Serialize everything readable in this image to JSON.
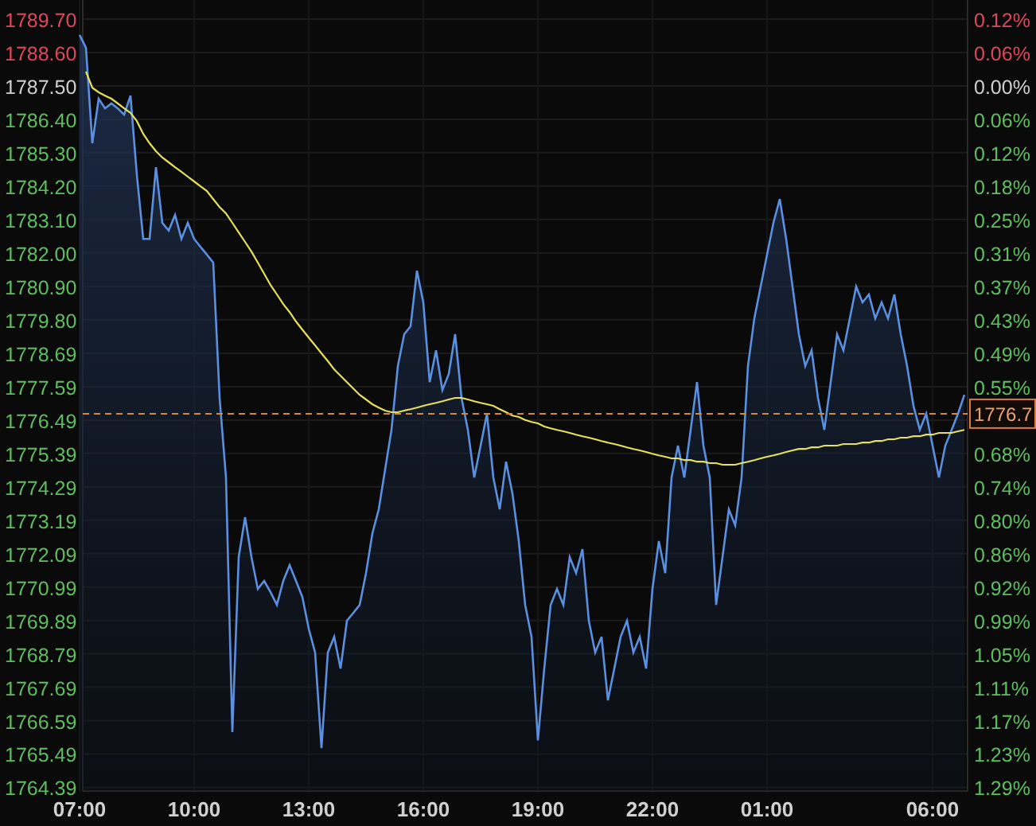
{
  "chart_data": {
    "type": "area",
    "grid": true,
    "ylim": [
      1764.27,
      1790.33
    ],
    "ref_lines": [
      {
        "axis": "y",
        "value": 1776.7,
        "label": "1776.7",
        "color": "#d08a3a"
      }
    ],
    "categories": [
      "07:00",
      null,
      null,
      null,
      null,
      null,
      null,
      null,
      null,
      null,
      null,
      null,
      null,
      null,
      null,
      null,
      null,
      null,
      "10:00",
      null,
      null,
      null,
      null,
      null,
      null,
      null,
      null,
      null,
      null,
      null,
      null,
      null,
      null,
      null,
      null,
      null,
      "13:00",
      null,
      null,
      null,
      null,
      null,
      null,
      null,
      null,
      null,
      null,
      null,
      null,
      null,
      null,
      null,
      null,
      null,
      "16:00",
      null,
      null,
      null,
      null,
      null,
      null,
      null,
      null,
      null,
      null,
      null,
      null,
      null,
      null,
      null,
      null,
      null,
      "19:00",
      null,
      null,
      null,
      null,
      null,
      null,
      null,
      null,
      null,
      null,
      null,
      null,
      null,
      null,
      null,
      null,
      null,
      "22:00",
      null,
      null,
      null,
      null,
      null,
      null,
      null,
      null,
      null,
      null,
      null,
      null,
      null,
      null,
      null,
      null,
      null,
      "01:00",
      null,
      null,
      null,
      null,
      null,
      null,
      null,
      null,
      null,
      null,
      null,
      null,
      null,
      null,
      null,
      null,
      null,
      null,
      null,
      null,
      null,
      null,
      null,
      null,
      null,
      "06:00",
      null,
      null,
      null,
      null,
      null
    ],
    "yticks": [
      {
        "value": 1789.7,
        "label": "1789.70"
      },
      {
        "value": 1788.6,
        "label": "1788.60"
      },
      {
        "value": 1787.5,
        "label": "1787.50"
      },
      {
        "value": 1786.4,
        "label": "1786.40"
      },
      {
        "value": 1785.3,
        "label": "1785.30"
      },
      {
        "value": 1784.2,
        "label": "1784.20"
      },
      {
        "value": 1783.1,
        "label": "1783.10"
      },
      {
        "value": 1782.0,
        "label": "1782.00"
      },
      {
        "value": 1780.9,
        "label": "1780.90"
      },
      {
        "value": 1779.8,
        "label": "1779.80"
      },
      {
        "value": 1778.69,
        "label": "1778.69"
      },
      {
        "value": 1777.59,
        "label": "1777.59"
      },
      {
        "value": 1776.49,
        "label": "1776.49"
      },
      {
        "value": 1775.39,
        "label": "1775.39"
      },
      {
        "value": 1774.29,
        "label": "1774.29"
      },
      {
        "value": 1773.19,
        "label": "1773.19"
      },
      {
        "value": 1772.09,
        "label": "1772.09"
      },
      {
        "value": 1770.99,
        "label": "1770.99"
      },
      {
        "value": 1769.89,
        "label": "1769.89"
      },
      {
        "value": 1768.79,
        "label": "1768.79"
      },
      {
        "value": 1767.69,
        "label": "1767.69"
      },
      {
        "value": 1766.59,
        "label": "1766.59"
      },
      {
        "value": 1765.49,
        "label": "1765.49"
      },
      {
        "value": 1764.39,
        "label": "1764.39"
      }
    ],
    "series": [
      {
        "color": "#5b8fe0",
        "type": "area",
        "values": [
          1789.18,
          1788.76,
          1785.61,
          1787.08,
          1786.76,
          1786.92,
          1786.76,
          1786.55,
          1787.18,
          1784.56,
          1782.46,
          1782.46,
          1784.82,
          1782.99,
          1782.73,
          1783.25,
          1782.46,
          1782.99,
          1782.46,
          1782.2,
          1781.94,
          1781.68,
          1777.22,
          1774.6,
          1766.21,
          1771.98,
          1773.29,
          1771.98,
          1770.93,
          1771.19,
          1770.82,
          1770.4,
          1771.19,
          1771.71,
          1771.19,
          1770.66,
          1769.62,
          1768.83,
          1765.68,
          1768.83,
          1769.35,
          1768.3,
          1769.88,
          1770.14,
          1770.4,
          1771.45,
          1772.76,
          1773.55,
          1774.86,
          1776.17,
          1778.27,
          1779.32,
          1779.58,
          1781.41,
          1780.37,
          1777.74,
          1778.79,
          1777.48,
          1778.01,
          1779.32,
          1777.22,
          1776.17,
          1774.6,
          1775.65,
          1776.7,
          1774.6,
          1773.55,
          1775.12,
          1774.07,
          1772.5,
          1770.4,
          1769.35,
          1765.94,
          1768.3,
          1770.4,
          1770.93,
          1770.4,
          1771.98,
          1771.45,
          1772.24,
          1769.88,
          1768.83,
          1769.35,
          1767.26,
          1768.3,
          1769.35,
          1769.88,
          1768.83,
          1769.35,
          1768.3,
          1770.93,
          1772.5,
          1771.45,
          1774.6,
          1775.65,
          1774.6,
          1776.17,
          1777.74,
          1775.65,
          1774.6,
          1770.4,
          1771.98,
          1773.55,
          1773.02,
          1774.6,
          1778.27,
          1779.84,
          1780.89,
          1781.94,
          1782.99,
          1783.77,
          1782.46,
          1780.89,
          1779.32,
          1778.27,
          1778.79,
          1777.22,
          1776.17,
          1777.74,
          1779.32,
          1778.79,
          1779.84,
          1780.89,
          1780.37,
          1780.63,
          1779.84,
          1780.37,
          1779.84,
          1780.63,
          1779.32,
          1778.27,
          1776.96,
          1776.17,
          1776.7,
          1775.65,
          1774.6,
          1775.65,
          1776.17,
          1776.7,
          1777.32
        ]
      },
      {
        "color": "#e6e05a",
        "type": "line",
        "values": [
          null,
          1787.97,
          1787.44,
          1787.29,
          1787.18,
          1787.08,
          1786.92,
          1786.76,
          1786.61,
          1786.34,
          1785.92,
          1785.61,
          1785.35,
          1785.14,
          1784.98,
          1784.82,
          1784.67,
          1784.51,
          1784.35,
          1784.19,
          1784.04,
          1783.77,
          1783.51,
          1783.3,
          1782.99,
          1782.67,
          1782.36,
          1782.04,
          1781.68,
          1781.31,
          1780.94,
          1780.63,
          1780.31,
          1780.05,
          1779.74,
          1779.47,
          1779.21,
          1778.95,
          1778.69,
          1778.43,
          1778.16,
          1777.95,
          1777.74,
          1777.53,
          1777.32,
          1777.17,
          1777.01,
          1776.9,
          1776.8,
          1776.75,
          1776.75,
          1776.8,
          1776.85,
          1776.9,
          1776.96,
          1777.01,
          1777.06,
          1777.11,
          1777.17,
          1777.22,
          1777.22,
          1777.17,
          1777.11,
          1777.06,
          1777.01,
          1776.96,
          1776.85,
          1776.75,
          1776.64,
          1776.59,
          1776.49,
          1776.43,
          1776.38,
          1776.28,
          1776.22,
          1776.17,
          1776.12,
          1776.07,
          1776.01,
          1775.96,
          1775.91,
          1775.86,
          1775.8,
          1775.75,
          1775.7,
          1775.65,
          1775.59,
          1775.54,
          1775.49,
          1775.44,
          1775.38,
          1775.33,
          1775.28,
          1775.23,
          1775.23,
          1775.17,
          1775.17,
          1775.12,
          1775.12,
          1775.07,
          1775.07,
          1775.02,
          1775.02,
          1775.02,
          1775.07,
          1775.12,
          1775.17,
          1775.23,
          1775.28,
          1775.33,
          1775.38,
          1775.44,
          1775.49,
          1775.54,
          1775.54,
          1775.59,
          1775.59,
          1775.65,
          1775.65,
          1775.65,
          1775.7,
          1775.7,
          1775.7,
          1775.75,
          1775.75,
          1775.8,
          1775.8,
          1775.86,
          1775.86,
          1775.91,
          1775.91,
          1775.96,
          1775.96,
          1776.01,
          1776.01,
          1776.07,
          1776.07,
          1776.07,
          1776.12,
          1776.17
        ]
      }
    ]
  },
  "rows": [
    {
      "pct": "0.12%",
      "color": "#e0475a"
    },
    {
      "pct": "0.06%",
      "color": "#e0475a"
    },
    {
      "pct": "0.00%",
      "color": "#cfcfcf"
    },
    {
      "pct": "0.06%",
      "color": "#5fbf5f"
    },
    {
      "pct": "0.12%",
      "color": "#5fbf5f"
    },
    {
      "pct": "0.18%",
      "color": "#5fbf5f"
    },
    {
      "pct": "0.25%",
      "color": "#5fbf5f"
    },
    {
      "pct": "0.31%",
      "color": "#5fbf5f"
    },
    {
      "pct": "0.37%",
      "color": "#5fbf5f"
    },
    {
      "pct": "0.43%",
      "color": "#5fbf5f"
    },
    {
      "pct": "0.49%",
      "color": "#5fbf5f"
    },
    {
      "pct": "0.55%",
      "color": "#5fbf5f"
    },
    {
      "color": "#5fbf5f"
    },
    {
      "pct": "0.68%",
      "color": "#5fbf5f"
    },
    {
      "pct": "0.74%",
      "color": "#5fbf5f"
    },
    {
      "pct": "0.80%",
      "color": "#5fbf5f"
    },
    {
      "pct": "0.86%",
      "color": "#5fbf5f"
    },
    {
      "pct": "0.92%",
      "color": "#5fbf5f"
    },
    {
      "pct": "0.99%",
      "color": "#5fbf5f"
    },
    {
      "pct": "1.05%",
      "color": "#5fbf5f"
    },
    {
      "pct": "1.11%",
      "color": "#5fbf5f"
    },
    {
      "pct": "1.17%",
      "color": "#5fbf5f"
    },
    {
      "pct": "1.23%",
      "color": "#5fbf5f"
    },
    {
      "pct": "1.29%",
      "color": "#5fbf5f"
    }
  ]
}
